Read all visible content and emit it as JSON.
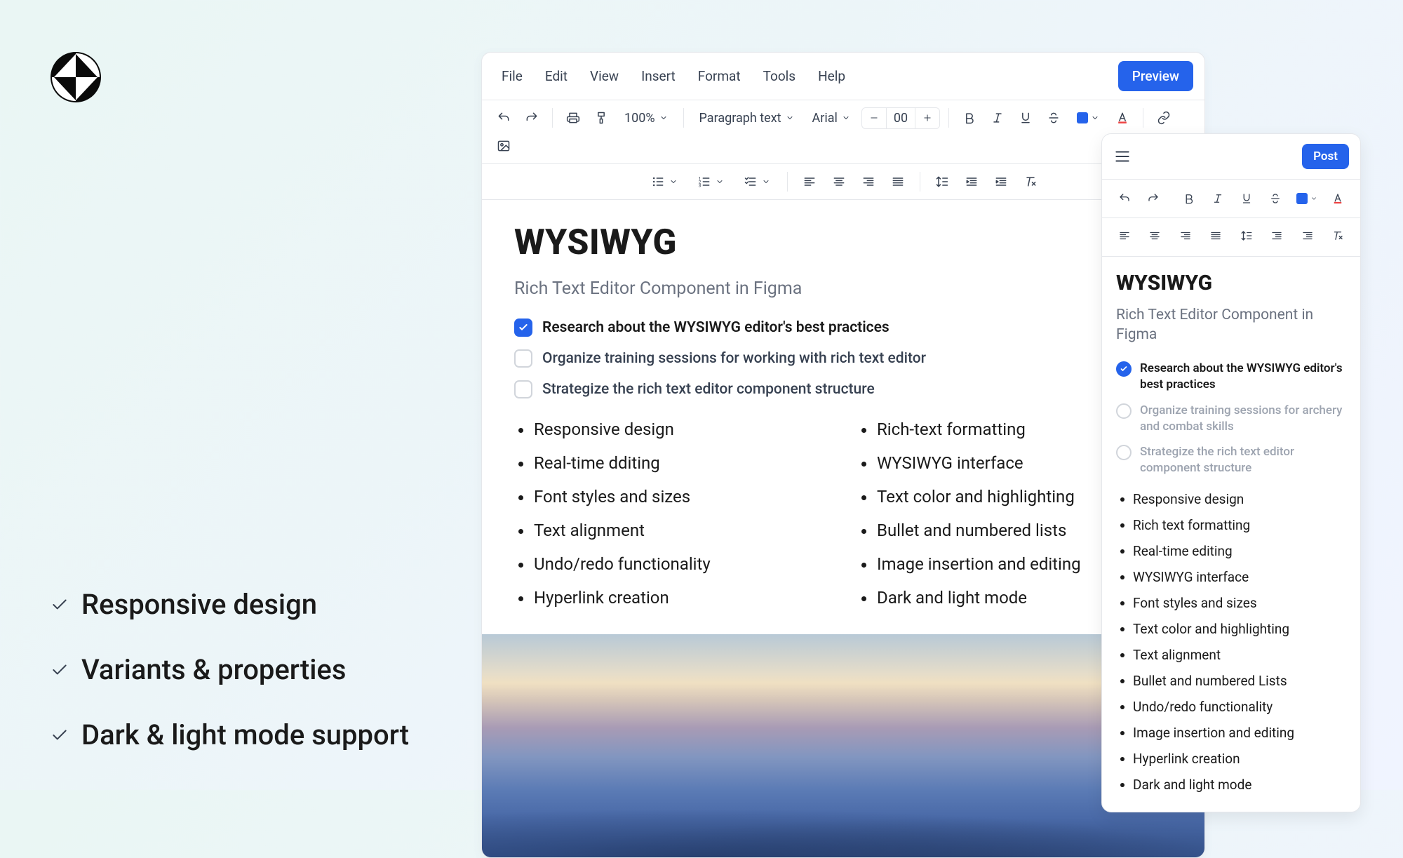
{
  "promo": {
    "items": [
      "Responsive design",
      "Variants & properties",
      "Dark & light mode support"
    ]
  },
  "editor": {
    "menubar": [
      "File",
      "Edit",
      "View",
      "Insert",
      "Format",
      "Tools",
      "Help"
    ],
    "preview_label": "Preview",
    "toolbar": {
      "zoom": "100%",
      "para_style": "Paragraph text",
      "font": "Arial",
      "font_size": "00"
    },
    "document": {
      "title": "WYSIWYG",
      "subtitle": "Rich Text Editor Component in Figma",
      "tasks": [
        {
          "checked": true,
          "label": "Research about the WYSIWYG editor's best practices"
        },
        {
          "checked": false,
          "label": "Organize training sessions for working with rich text editor"
        },
        {
          "checked": false,
          "label": "Strategize the rich text editor component structure"
        }
      ],
      "col1": [
        "Responsive design",
        "Real-time dditing",
        "Font styles and sizes",
        "Text alignment",
        "Undo/redo functionality",
        "Hyperlink creation"
      ],
      "col2": [
        "Rich-text formatting",
        "WYSIWYG interface",
        "Text color and highlighting",
        "Bullet and numbered lists",
        "Image insertion and editing",
        "Dark and light mode"
      ]
    }
  },
  "mobile": {
    "post_label": "Post",
    "document": {
      "title": "WYSIWYG",
      "subtitle": "Rich Text Editor Component in Figma",
      "tasks": [
        {
          "checked": true,
          "label": "Research about the WYSIWYG editor's best practices"
        },
        {
          "checked": false,
          "label": "Organize training sessions for archery and combat skills"
        },
        {
          "checked": false,
          "label": "Strategize the rich text editor component structure"
        }
      ],
      "list": [
        "Responsive design",
        "Rich text formatting",
        "Real-time editing",
        "WYSIWYG interface",
        "Font styles and sizes",
        "Text color and highlighting",
        "Text alignment",
        "Bullet and numbered Lists",
        "Undo/redo functionality",
        "Image insertion and editing",
        "Hyperlink creation",
        "Dark and light mode"
      ]
    }
  },
  "colors": {
    "accent": "#2563eb"
  }
}
